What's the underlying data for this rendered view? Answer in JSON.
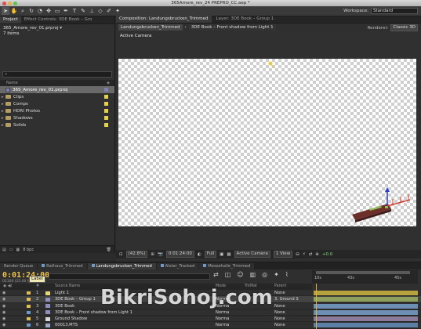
{
  "window": {
    "title": "365Amore_rev_24 PREPRO_CC.aep *"
  },
  "toolbar": {
    "tools": [
      "arrow-tool-icon",
      "hand-tool-icon",
      "zoom-tool-icon",
      "rotate-tool-icon",
      "camera-orbit-icon",
      "pan-behind-icon",
      "rectangle-tool-icon",
      "pen-tool-icon",
      "type-tool-icon",
      "brush-tool-icon",
      "clone-stamp-icon",
      "eraser-tool-icon",
      "roto-brush-icon",
      "puppet-pin-icon"
    ],
    "workspace_label": "Workspace:",
    "workspace_value": "Standard"
  },
  "project": {
    "tab": "Project",
    "tab2": "Effect Controls: 3DE Book – Gro",
    "file": "365_Amore_rev_01.prproj ▾",
    "items_count": "7 items",
    "search_icon": "magnifier-icon",
    "col_name": "Name",
    "items": [
      {
        "label": "365_Amore_rev_01.prproj",
        "type": "project",
        "color": "#7f7fb5",
        "selected": true
      },
      {
        "label": "Clips",
        "type": "folder",
        "color": "#e6d24a"
      },
      {
        "label": "Comps",
        "type": "folder",
        "color": "#e6d24a"
      },
      {
        "label": "HDRI Photos",
        "type": "folder",
        "color": "#e6d24a"
      },
      {
        "label": "Shadows",
        "type": "folder",
        "color": "#e6d24a"
      },
      {
        "label": "Solids",
        "type": "folder",
        "color": "#e6d24a"
      }
    ],
    "footer_bpc": "8 bpc"
  },
  "composition": {
    "tab": "Composition: Landungsbrucken_Trimmed",
    "tab_layer": "Layer: 3DE Book – Group 1",
    "subtab1": "Landungsbrucken_Trimmed",
    "subtab2": "3DE Book – Front shadow from Light 1",
    "renderer_label": "Renderer:",
    "renderer_value": "Classic 3D",
    "active_camera": "Active Camera",
    "footer": {
      "zoom": "(42.8%)",
      "timecode": "0:01:24:00",
      "resolution": "Full",
      "view": "Active Camera",
      "views": "1 View",
      "exposure": "+0.0"
    }
  },
  "timeline": {
    "tabs": [
      {
        "label": "Render Queue",
        "color": ""
      },
      {
        "label": "Rathaus_Trimmed",
        "color": "#6d9ac9"
      },
      {
        "label": "Landungsbrucken_Trimmed",
        "color": "#6d9ac9",
        "active": true
      },
      {
        "label": "Alster_Tracked",
        "color": "#6d9ac9"
      },
      {
        "label": "Messehalle_Trimmed",
        "color": "#6d9ac9"
      }
    ],
    "timecode": "0:01:24:00",
    "frames": "02100 (25.00 fps)",
    "tooltip": "Label",
    "ruler": [
      "10s",
      "43s",
      "45s"
    ],
    "col_source": "Source Name",
    "col_mode": "Mode",
    "col_trkmat": "TrkMat",
    "col_parent": "Parent",
    "layers": [
      {
        "num": "1",
        "name": "Light 1",
        "label": "#e0c050",
        "icon": "light",
        "mode": "",
        "parent": "None",
        "bar": "#b7a33d"
      },
      {
        "num": "2",
        "name": "3DE Book – Group 1",
        "label": "#e0c050",
        "icon": "comp",
        "mode": "Norma",
        "parent": "3. Ground S",
        "bar": "#8fa05c",
        "selected": true
      },
      {
        "num": "3",
        "name": "3DE Book",
        "label": "#e0c050",
        "icon": "comp",
        "mode": "Norma",
        "parent": "None",
        "bar": "#6c8fb3"
      },
      {
        "num": "4",
        "name": "3DE Book – Front shadow from Light 1",
        "label": "#6d9ac9",
        "icon": "comp",
        "mode": "Norma",
        "parent": "None",
        "bar": "#6c8fb3"
      },
      {
        "num": "5",
        "name": "Ground Shadow",
        "label": "#e0c050",
        "icon": "solid",
        "mode": "Norma",
        "parent": "None",
        "bar": "#8b7a9a"
      },
      {
        "num": "6",
        "name": "00013.MTS",
        "label": "#6d9ac9",
        "icon": "footage",
        "mode": "Norma",
        "parent": "None",
        "bar": "#5d7fa6"
      }
    ]
  },
  "watermark": "BikriSohoj.com"
}
